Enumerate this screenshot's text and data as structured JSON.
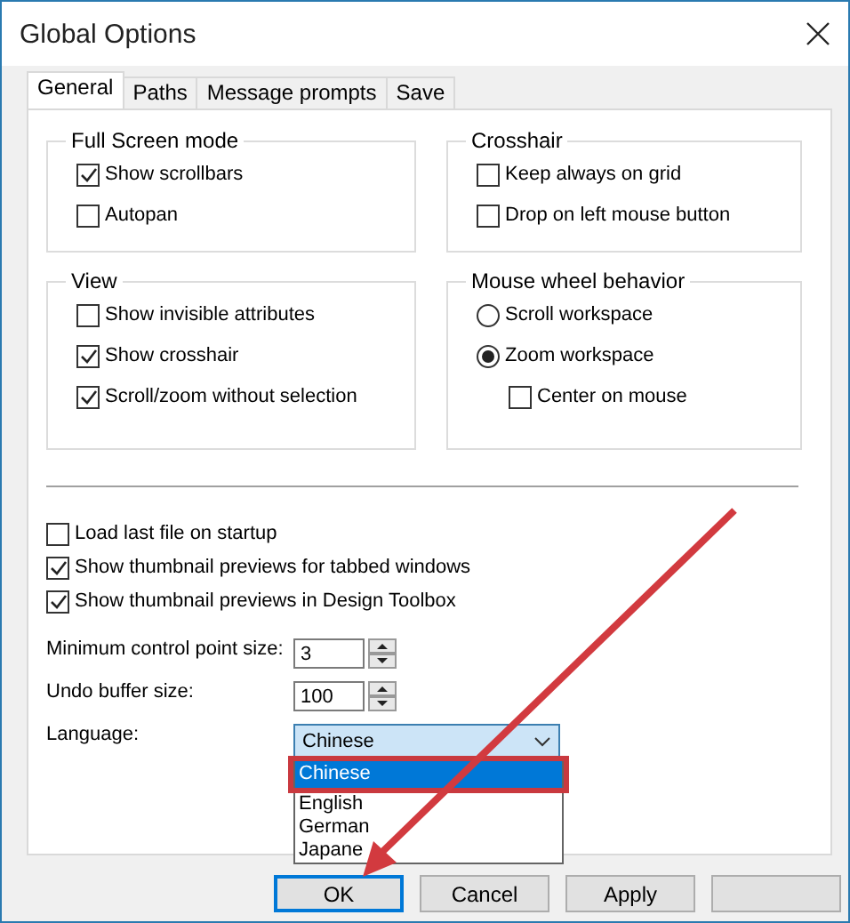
{
  "window": {
    "title": "Global Options"
  },
  "tabs": [
    {
      "label": "General",
      "selected": true
    },
    {
      "label": "Paths",
      "selected": false
    },
    {
      "label": "Message prompts",
      "selected": false
    },
    {
      "label": "Save",
      "selected": false
    }
  ],
  "groups": [
    {
      "title": "Full Screen mode",
      "items": [
        {
          "kind": "checkbox",
          "label": "Show scrollbars",
          "checked": true
        },
        {
          "kind": "checkbox",
          "label": "Autopan",
          "checked": false
        }
      ]
    },
    {
      "title": "Crosshair",
      "items": [
        {
          "kind": "checkbox",
          "label": "Keep always on grid",
          "checked": false
        },
        {
          "kind": "checkbox",
          "label": "Drop on left mouse button",
          "checked": false
        }
      ]
    },
    {
      "title": "View",
      "items": [
        {
          "kind": "checkbox",
          "label": "Show invisible attributes",
          "checked": false
        },
        {
          "kind": "checkbox",
          "label": "Show crosshair",
          "checked": true
        },
        {
          "kind": "checkbox",
          "label": "Scroll/zoom without selection",
          "checked": true
        }
      ]
    },
    {
      "title": "Mouse wheel behavior",
      "items": [
        {
          "kind": "radio",
          "label": "Scroll workspace",
          "selected": false
        },
        {
          "kind": "radio",
          "label": "Zoom workspace",
          "selected": true
        },
        {
          "kind": "subcheckbox",
          "label": "Center on mouse",
          "checked": false
        }
      ]
    }
  ],
  "options": [
    {
      "label": "Load last file on startup",
      "checked": false
    },
    {
      "label": "Show thumbnail previews for tabbed windows",
      "checked": true
    },
    {
      "label": "Show thumbnail previews in Design Toolbox",
      "checked": true
    }
  ],
  "spin_fields": [
    {
      "label": "Minimum control point size:",
      "value": "3"
    },
    {
      "label": "Undo buffer size:",
      "value": "100"
    }
  ],
  "language": {
    "label": "Language:",
    "value": "Chinese",
    "options": [
      {
        "label": "Chinese",
        "selected": true
      },
      {
        "label": "English",
        "selected": false
      },
      {
        "label": "German",
        "selected": false
      },
      {
        "label": "Japane",
        "selected": false
      }
    ]
  },
  "buttons": [
    {
      "label": "OK",
      "default": true
    },
    {
      "label": "Cancel",
      "default": false
    },
    {
      "label": "Apply",
      "default": false
    },
    {
      "default": false
    }
  ],
  "annotations": {
    "highlight_frame": true,
    "arrow": true
  }
}
